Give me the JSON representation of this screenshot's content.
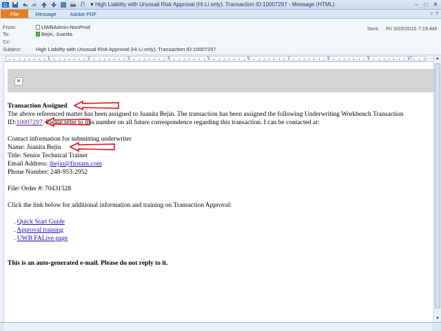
{
  "window": {
    "title": "High Liability with Unusual Risk Approval (Hi Li only). Transaction ID:10007297 - Message (HTML)",
    "file_tab": "File",
    "tabs": [
      "Message",
      "Adobe PDF"
    ]
  },
  "header": {
    "from_label": "From:",
    "from_value": "UWBAdmin-NonProd",
    "to_label": "To:",
    "to_value": "Bejin, Juanita",
    "cc_label": "Cc:",
    "subject_label": "Subject:",
    "subject_value": "High Liability with Unusual Risk Approval (Hi Li only). Transaction ID:10007297",
    "sent_label": "Sent:",
    "sent_value": "Fri 3/20/2015 7:19 AM"
  },
  "ruler": {
    "numbers": [
      "1",
      "2",
      "3",
      "4",
      "5",
      "6",
      "7",
      "8",
      "9",
      "10"
    ]
  },
  "body": {
    "heading": "Transaction Assigned",
    "line1": "The above referenced matter has been assigned to Juanita Bejin. The transaction has been assigned the following Underwriting Workbench Transaction",
    "id_prefix": "ID:",
    "transaction_id": "10007297",
    "line2_rest": ". Please refer to this number on all future correspondence regarding this transaction. I can be contacted at:",
    "contact_heading": "Contact information for submitting underwriter",
    "name": "Name: Juanita Bejin",
    "title": "Title: Senior Technical Trainer",
    "email_label": "Email Address: ",
    "email": "jbejin@firstam.com",
    "phone": "Phone Number: 248-953-2952",
    "file_order": "File/ Order #: 70431528",
    "training_intro": "Click the link below for additional information and training on Transaction Approval:",
    "links": [
      {
        "label": "Quick Start Guide"
      },
      {
        "label": "Approval training"
      },
      {
        "label": "UWB FALive page"
      }
    ],
    "footer": "This is an auto-generated e-mail. Please do not reply to it."
  },
  "colors": {
    "accent_file": "#e77c1f",
    "arrow": "#e0101a",
    "link": "#1a0dab"
  }
}
